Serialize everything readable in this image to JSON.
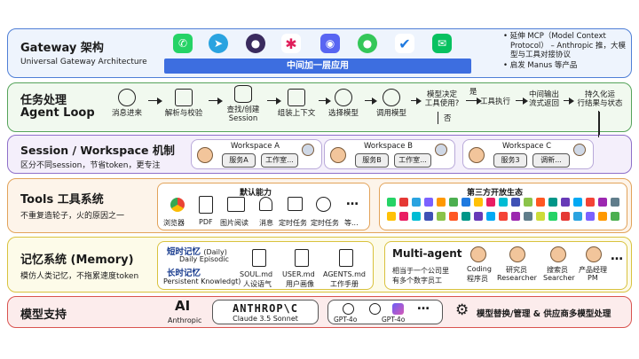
{
  "gateway": {
    "title": "Gateway 架构",
    "subtitle": "Universal Gateway Architecture",
    "bar_label": "中间加一层应用",
    "notes": [
      "延伸 MCP（Model Context Protocol） – Anthropic 推，大模型与工具对接协议",
      "启发 Manus 等产品"
    ],
    "apps": [
      "whatsapp-icon",
      "telegram-icon",
      "signal-icon",
      "slack-icon",
      "discord-icon",
      "imessage-icon",
      "feishu-icon",
      "wechat-icon"
    ],
    "colors": {
      "border": "#4f7fd6",
      "bg": "#eef4fd",
      "bar": "#3d6ee0"
    }
  },
  "agent_loop": {
    "title": "任务处理",
    "title2": "Agent Loop",
    "steps": [
      "消息进来",
      "解析与校验",
      "查找/创建",
      "Session",
      "组装上下文",
      "选择模型",
      "调用模型"
    ],
    "decision": [
      "模型决定",
      "工具使用?"
    ],
    "yes": "是",
    "no": "否",
    "tool_exec": "工具执行",
    "stream": [
      "中间输出",
      "流式返回"
    ],
    "persist": [
      "持久化运",
      "行结果与状态"
    ],
    "colors": {
      "border": "#55a35a",
      "bg": "#f1f9ef"
    }
  },
  "session": {
    "title": "Session / Workspace 机制",
    "subtitle": "区分不同session，节省token，更专注",
    "workspaces": [
      {
        "name": "Workspace A",
        "left": "服务A",
        "right": "工作室..."
      },
      {
        "name": "Workspace B",
        "left": "服务B",
        "right": "工作室..."
      },
      {
        "name": "Workspace C",
        "left": "服务3",
        "right": "调新..."
      }
    ],
    "colors": {
      "border": "#8e6fc9",
      "bg": "#f4effb"
    }
  },
  "tools": {
    "title": "Tools 工具系统",
    "subtitle": "不重复造轮子，火的原因之一",
    "default_title": "默认能力",
    "default_items": [
      "浏览器",
      "PDF",
      "图片阅读",
      "消息",
      "定时任务",
      "定时任务",
      "等..."
    ],
    "default_icons": [
      "chrome-icon",
      "pdf-icon",
      "image-icon",
      "bell-icon",
      "calendar-icon",
      "timer-icon",
      "ellipsis-icon"
    ],
    "ellipsis": "…",
    "third_title": "第三方开放生态",
    "colors": {
      "border": "#e2a35a",
      "bg": "#fdf4ea"
    }
  },
  "memory": {
    "title": "记忆系统 (Memory)",
    "subtitle": "模仿人类记忆，不拖累速度token",
    "short": "短时记忆",
    "short_en1": "(Daily)",
    "short_en2": "Daily Episodic",
    "long": "长时记忆",
    "long_en": "Persistent Knowledgt)",
    "docs": [
      {
        "name": "SOUL.md",
        "desc": "人设语气"
      },
      {
        "name": "USER.md",
        "desc": "用户画像"
      },
      {
        "name": "AGENTS.md",
        "desc": "工作手册"
      }
    ],
    "colors": {
      "border": "#d9c23e",
      "bg": "#fdfbe9"
    }
  },
  "multi_agent": {
    "title": "Multi-agent",
    "desc": [
      "相当于一个公司里",
      "有多个数字员工"
    ],
    "roles": [
      {
        "cn": "Coding",
        "en": "程序员"
      },
      {
        "cn": "研究员",
        "en": "Researcher"
      },
      {
        "cn": "搜索员",
        "en": "Searcher"
      },
      {
        "cn": "产品经理",
        "en": "PM"
      }
    ],
    "ellipsis": "…"
  },
  "models": {
    "title": "模型支持",
    "anthropic": "Anthropic",
    "anthropic_logo": "AI",
    "anthropic_big": "ANTHROP\\C",
    "claude": "Claude 3.5 Sonnet",
    "gpt1": "GPT-4o",
    "gpt2": "GPT-4o",
    "ellipsis": "…",
    "right_text": "模型替换/管理 & 供应商多模型处理",
    "colors": {
      "border": "#d9534f",
      "bg": "#fcecec"
    }
  }
}
